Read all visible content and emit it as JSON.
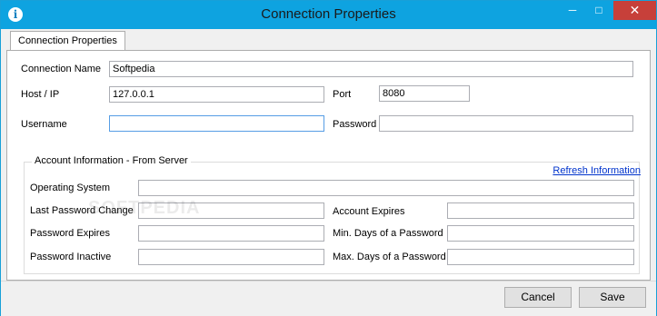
{
  "window": {
    "title": "Connection Properties",
    "app_icon": "info-icon"
  },
  "titlebar_buttons": {
    "minimize": "─",
    "maximize": "□",
    "close": "✕"
  },
  "tabs": [
    {
      "label": "Connection Properties",
      "active": true
    }
  ],
  "connection": {
    "name_label": "Connection Name",
    "name_value": "Softpedia",
    "host_label": "Host / IP",
    "host_value": "127.0.0.1",
    "port_label": "Port",
    "port_value": "8080",
    "username_label": "Username",
    "username_value": "",
    "password_label": "Password",
    "password_value": ""
  },
  "account": {
    "group_title": "Account Information - From Server",
    "refresh_link": "Refresh Information",
    "os_label": "Operating System",
    "os_value": "",
    "last_pw_change_label": "Last Password Change",
    "last_pw_change_value": "",
    "account_expires_label": "Account Expires",
    "account_expires_value": "",
    "pw_expires_label": "Password Expires",
    "pw_expires_value": "",
    "min_days_label": "Min. Days of a Password",
    "min_days_value": "",
    "pw_inactive_label": "Password Inactive",
    "pw_inactive_value": "",
    "max_days_label": "Max. Days of a Password",
    "max_days_value": ""
  },
  "buttons": {
    "cancel": "Cancel",
    "save": "Save"
  },
  "watermark": "SOFTPEDIA",
  "colors": {
    "titlebar": "#0ea3e0",
    "close": "#c7403a",
    "link": "#0033cc",
    "focus_border": "#569de5"
  }
}
